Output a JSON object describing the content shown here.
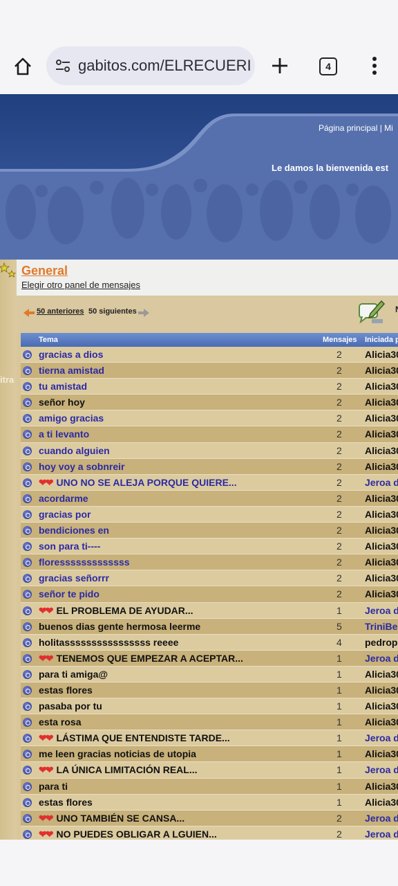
{
  "browser": {
    "url": "gabitos.com/ELRECUERI",
    "tab_count": "4"
  },
  "header": {
    "nav_links": "Página principal  |  Mi",
    "welcome": "Le damos la bienvenida est"
  },
  "board": {
    "side_label": "itra",
    "forum_title": "General",
    "other_panel": "Elegir otro panel de mensajes",
    "prev_link": "50 anteriores",
    "next_link": "50 siguientes",
    "new_topic_label": "N"
  },
  "table": {
    "col_topic": "Tema",
    "col_messages": "Mensajes",
    "col_started": "Iniciada p",
    "rows": [
      {
        "hearts": "",
        "title": "gracias a dios",
        "count": "2",
        "author": "Alicia30",
        "title_color": "blue",
        "author_color": "dark"
      },
      {
        "hearts": "",
        "title": "tierna amistad",
        "count": "2",
        "author": "Alicia30",
        "title_color": "blue",
        "author_color": "dark"
      },
      {
        "hearts": "",
        "title": "tu amistad",
        "count": "2",
        "author": "Alicia30",
        "title_color": "blue",
        "author_color": "dark"
      },
      {
        "hearts": "",
        "title": "señor hoy",
        "count": "2",
        "author": "Alicia30",
        "title_color": "dark",
        "author_color": "dark"
      },
      {
        "hearts": "",
        "title": "amigo gracias",
        "count": "2",
        "author": "Alicia30",
        "title_color": "blue",
        "author_color": "dark"
      },
      {
        "hearts": "",
        "title": "a ti levanto",
        "count": "2",
        "author": "Alicia30",
        "title_color": "blue",
        "author_color": "dark"
      },
      {
        "hearts": "",
        "title": "cuando alguien",
        "count": "2",
        "author": "Alicia30",
        "title_color": "blue",
        "author_color": "dark"
      },
      {
        "hearts": "",
        "title": "hoy voy a sobnreir",
        "count": "2",
        "author": "Alicia30",
        "title_color": "blue",
        "author_color": "dark"
      },
      {
        "hearts": "❤❤",
        "title": "UNO NO SE ALEJA PORQUE QUIERE...",
        "count": "2",
        "author": "Jeroa d",
        "title_color": "blue",
        "author_color": "blue"
      },
      {
        "hearts": "",
        "title": "acordarme",
        "count": "2",
        "author": "Alicia30",
        "title_color": "blue",
        "author_color": "dark"
      },
      {
        "hearts": "",
        "title": "gracias por",
        "count": "2",
        "author": "Alicia30",
        "title_color": "blue",
        "author_color": "dark"
      },
      {
        "hearts": "",
        "title": "bendiciones en",
        "count": "2",
        "author": "Alicia30",
        "title_color": "blue",
        "author_color": "dark"
      },
      {
        "hearts": "",
        "title": "son para ti----",
        "count": "2",
        "author": "Alicia30",
        "title_color": "blue",
        "author_color": "dark"
      },
      {
        "hearts": "",
        "title": "floresssssssssssss",
        "count": "2",
        "author": "Alicia30",
        "title_color": "blue",
        "author_color": "dark"
      },
      {
        "hearts": "",
        "title": "gracias señorrr",
        "count": "2",
        "author": "Alicia30",
        "title_color": "blue",
        "author_color": "dark"
      },
      {
        "hearts": "",
        "title": "señor te pido",
        "count": "2",
        "author": "Alicia30",
        "title_color": "blue",
        "author_color": "dark"
      },
      {
        "hearts": "❤❤",
        "title": "EL PROBLEMA DE AYUDAR...",
        "count": "1",
        "author": "Jeroa d",
        "title_color": "dark",
        "author_color": "blue"
      },
      {
        "hearts": "",
        "title": "buenos dias gente hermosa leerme",
        "count": "5",
        "author": "TriniBe",
        "title_color": "dark",
        "author_color": "blue"
      },
      {
        "hearts": "",
        "title": "holitassssssssssssssss reeee",
        "count": "4",
        "author": "pedrop",
        "title_color": "dark",
        "author_color": "dark"
      },
      {
        "hearts": "❤❤",
        "title": "TENEMOS QUE EMPEZAR A ACEPTAR...",
        "count": "1",
        "author": "Jeroa d",
        "title_color": "dark",
        "author_color": "blue"
      },
      {
        "hearts": "",
        "title": "para ti amiga@",
        "count": "1",
        "author": "Alicia30",
        "title_color": "dark",
        "author_color": "dark"
      },
      {
        "hearts": "",
        "title": "estas flores",
        "count": "1",
        "author": "Alicia30",
        "title_color": "dark",
        "author_color": "dark"
      },
      {
        "hearts": "",
        "title": "pasaba por tu",
        "count": "1",
        "author": "Alicia30",
        "title_color": "dark",
        "author_color": "dark"
      },
      {
        "hearts": "",
        "title": "esta rosa",
        "count": "1",
        "author": "Alicia30",
        "title_color": "dark",
        "author_color": "dark"
      },
      {
        "hearts": "❤❤",
        "title": "LÁSTIMA QUE ENTENDISTE TARDE...",
        "count": "1",
        "author": "Jeroa d",
        "title_color": "dark",
        "author_color": "blue"
      },
      {
        "hearts": "",
        "title": "me leen gracias noticias de utopia",
        "count": "1",
        "author": "Alicia30",
        "title_color": "dark",
        "author_color": "dark"
      },
      {
        "hearts": "❤❤",
        "title": "LA ÚNICA LIMITACIÓN REAL...",
        "count": "1",
        "author": "Jeroa d",
        "title_color": "dark",
        "author_color": "blue"
      },
      {
        "hearts": "",
        "title": "para ti",
        "count": "1",
        "author": "Alicia30",
        "title_color": "dark",
        "author_color": "dark"
      },
      {
        "hearts": "",
        "title": "estas flores",
        "count": "1",
        "author": "Alicia30",
        "title_color": "dark",
        "author_color": "dark"
      },
      {
        "hearts": "❤❤",
        "title": "UNO TAMBIÉN SE CANSA...",
        "count": "2",
        "author": "Jeroa d",
        "title_color": "dark",
        "author_color": "blue"
      },
      {
        "hearts": "❤❤",
        "title": "NO PUEDES OBLIGAR A LGUIEN...",
        "count": "2",
        "author": "Jeroa d",
        "title_color": "dark",
        "author_color": "blue"
      }
    ]
  }
}
